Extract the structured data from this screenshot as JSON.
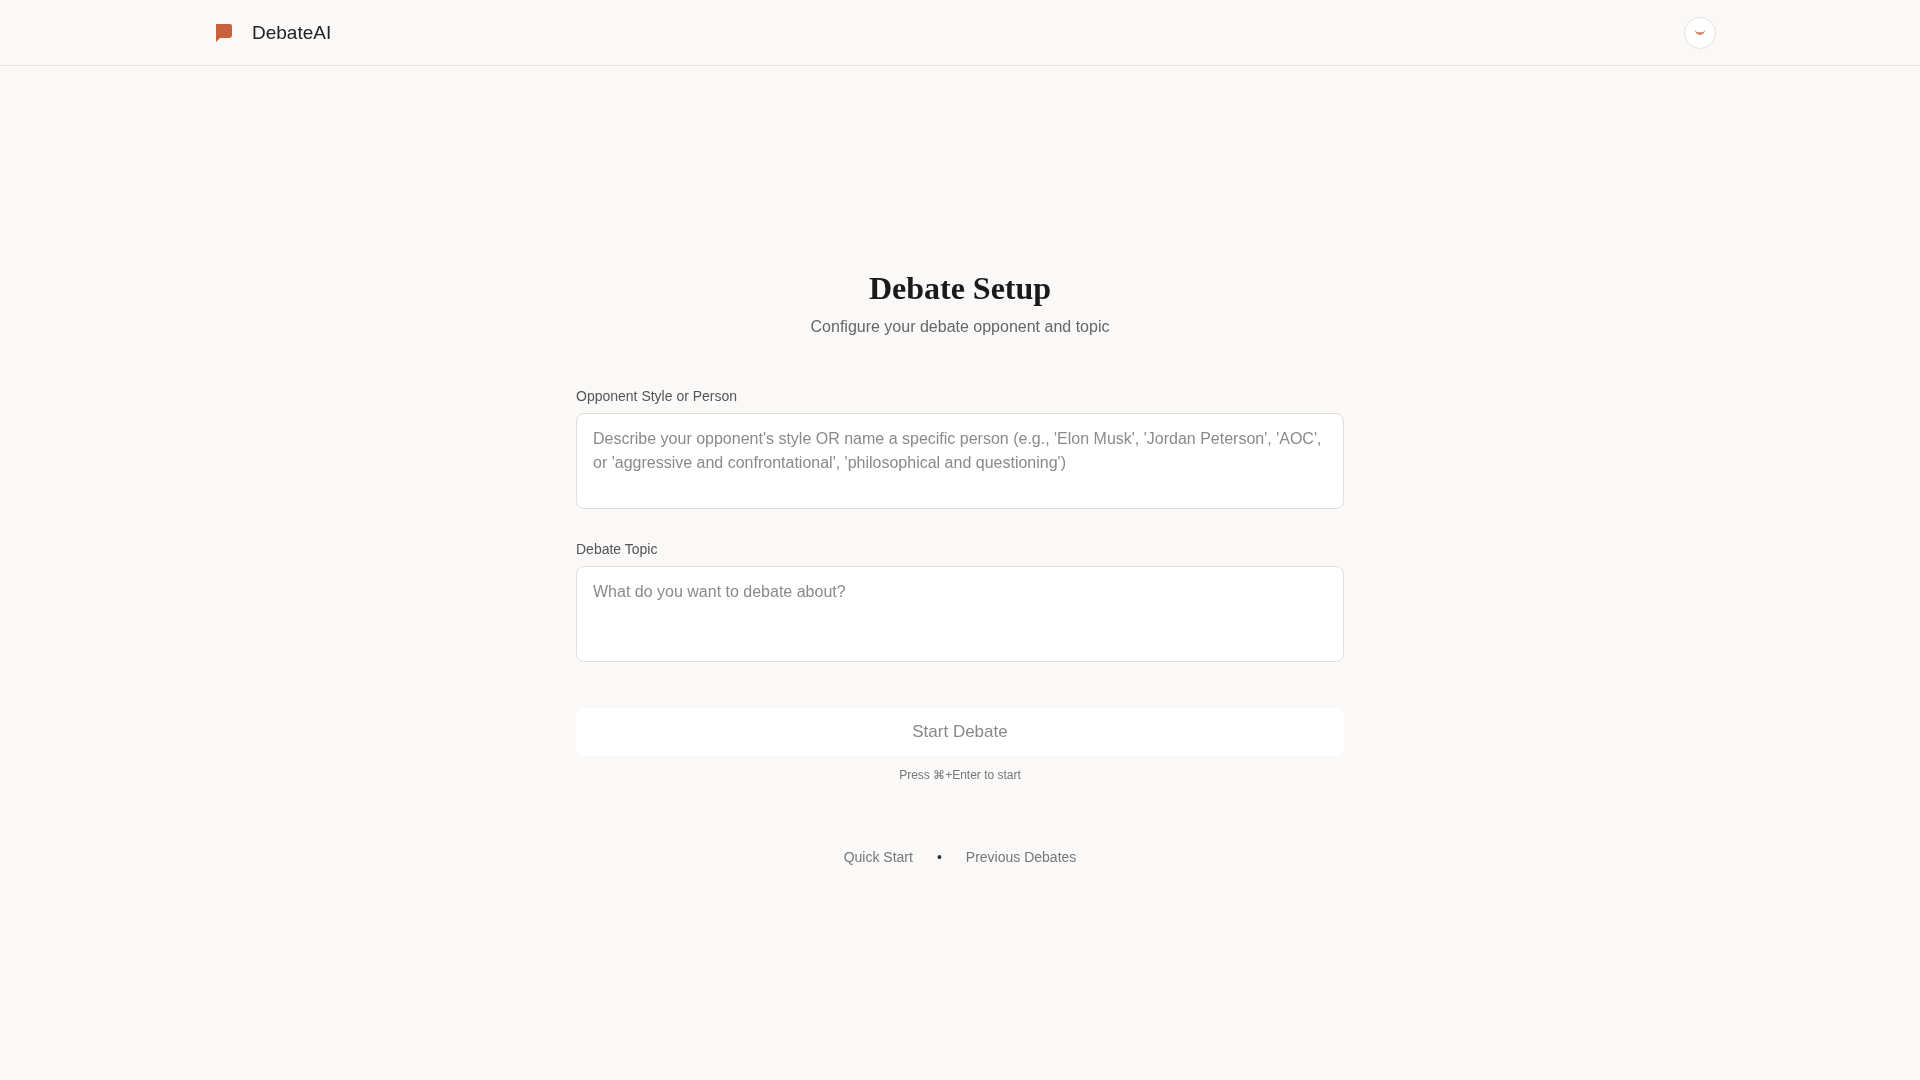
{
  "header": {
    "brand": "DebateAI"
  },
  "title": "Debate Setup",
  "subtitle": "Configure your debate opponent and topic",
  "fields": [
    {
      "label": "Opponent Style or Person",
      "placeholder": "Describe your opponent's style OR name a specific person (e.g., 'Elon Musk', 'Jordan Peterson', 'AOC', or 'aggressive and confrontational', 'philosophical and questioning')"
    },
    {
      "label": "Debate Topic",
      "placeholder": "What do you want to debate about?"
    }
  ],
  "start_button": {
    "label": "Start Debate",
    "disabled": true
  },
  "hint": "Press ⌘+Enter to start",
  "footer_links": [
    "Quick Start",
    "Previous Debates"
  ],
  "separator": "•"
}
